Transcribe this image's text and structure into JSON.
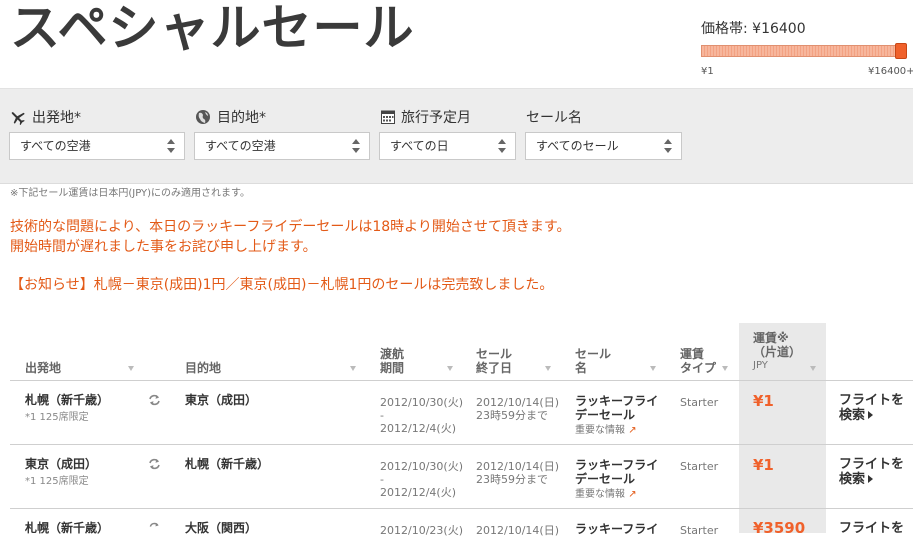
{
  "page_title": "スペシャルセール",
  "filters": {
    "origin_label": "出発地*",
    "origin_value": "すべての空港",
    "destination_label": "目的地*",
    "destination_value": "すべての空港",
    "month_label": "旅行予定月",
    "month_value": "すべての日",
    "sale_label": "セール名",
    "sale_value": "すべてのセール",
    "price_label": "価格帯: ¥16400",
    "price_min": "¥1",
    "price_max": "¥16400+",
    "price_level_fraction": 1.0
  },
  "note": "※下記セール運賃は日本円(JPY)にのみ適用されます。",
  "notices": [
    "技術的な問題により、本日のラッキーフライデーセールは18時より開始させて頂きます。",
    "開始時間が遅れました事をお詫び申し上げます。",
    "【お知らせ】札幌－東京(成田)1円／東京(成田)－札幌1円のセールは完売致しました。"
  ],
  "table": {
    "headers": {
      "origin": "出発地",
      "destination": "目的地",
      "travel_period_1": "渡航",
      "travel_period_2": "期間",
      "sale_end_1": "セール",
      "sale_end_2": "終了日",
      "sale_name_1": "セール",
      "sale_name_2": "名",
      "fare_type_1": "運賃",
      "fare_type_2": "タイプ",
      "fare_1": "運賃※",
      "fare_2": "（片道）",
      "fare_currency": "JPY"
    },
    "rows": [
      {
        "origin": "札幌（新千歳）",
        "origin_note": "*1 125席限定",
        "destination": "東京（成田）",
        "period_start": "2012/10/30(火)",
        "period_dash": "-",
        "period_end": "2012/12/4(火)",
        "sale_end_date": "2012/10/14(日)",
        "sale_end_time": "23時59分まで",
        "sale_name_1": "ラッキーフライ",
        "sale_name_2": "デーセール",
        "important": "重要な情報",
        "fare_type": "Starter",
        "fare": "¥1",
        "search_1": "フライトを",
        "search_2": "検索"
      },
      {
        "origin": "東京（成田）",
        "origin_note": "*1 125席限定",
        "destination": "札幌（新千歳）",
        "period_start": "2012/10/30(火)",
        "period_dash": "-",
        "period_end": "2012/12/4(火)",
        "sale_end_date": "2012/10/14(日)",
        "sale_end_time": "23時59分まで",
        "sale_name_1": "ラッキーフライ",
        "sale_name_2": "デーセール",
        "important": "重要な情報",
        "fare_type": "Starter",
        "fare": "¥1",
        "search_1": "フライトを",
        "search_2": "検索"
      },
      {
        "origin": "札幌（新千歳）",
        "destination": "大阪（関西）",
        "period_start": "2012/10/23(火)",
        "sale_end_date": "2012/10/14(日)",
        "sale_name_1": "ラッキーフライ",
        "fare_type": "Starter",
        "fare": "¥3590",
        "search_1": "フライトを"
      }
    ]
  }
}
